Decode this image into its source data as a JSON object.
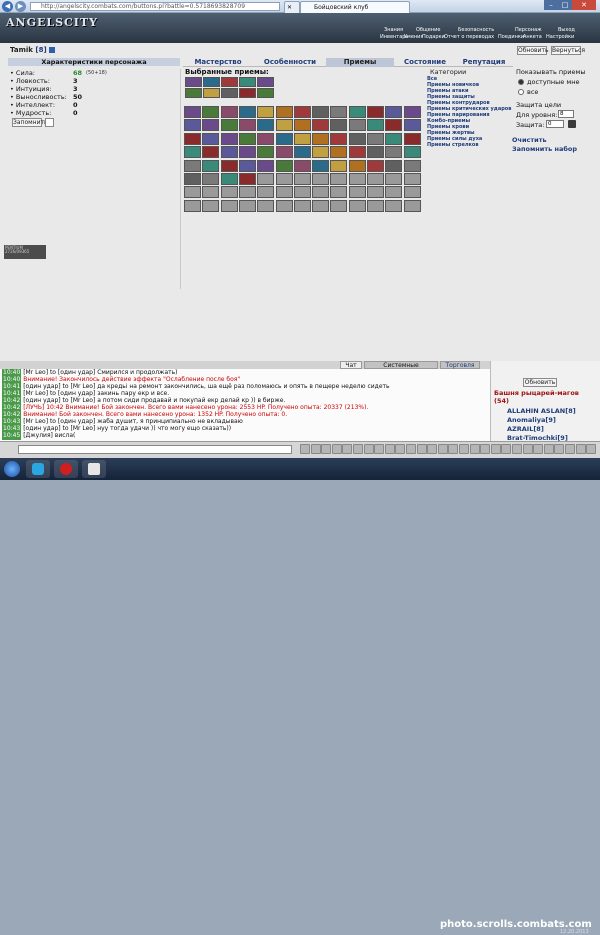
{
  "browser": {
    "url": "http://angelscity.combats.com/buttons.pl?battle=0.5718693828709",
    "tab_title": "Бойцовский клуб",
    "back_icon": "back-arrow-icon",
    "forward_icon": "forward-arrow-icon"
  },
  "game": {
    "logo": "ANGELSCITY",
    "menu_top": [
      "Знания",
      "Общение",
      "Безопасность",
      "Персонаж",
      "Выход"
    ],
    "menu_bottom": [
      "Инвентарь",
      "Умения",
      "Подарки",
      "Отчет о переводах",
      "Поединки",
      "Анкета",
      "Настройки"
    ]
  },
  "character": {
    "name": "Tamik",
    "level": "[8]",
    "update_btn": "Обновить",
    "back_btn": "Вернуться"
  },
  "stats": {
    "title": "Характеристики персонажа",
    "rows": [
      {
        "label": "Сила:",
        "value": "68",
        "bonus": "(50+18)"
      },
      {
        "label": "Ловкость:",
        "value": "3",
        "bonus": ""
      },
      {
        "label": "Интуиция:",
        "value": "3",
        "bonus": ""
      },
      {
        "label": "Выносливость:",
        "value": "50",
        "bonus": ""
      },
      {
        "label": "Интеллект:",
        "value": "0",
        "bonus": ""
      },
      {
        "label": "Мудрость:",
        "value": "0",
        "bonus": ""
      }
    ],
    "remember_btn": "Запомнить"
  },
  "tabs": [
    "Мастерство",
    "Особенности",
    "Приемы",
    "Состояние",
    "Репутация"
  ],
  "active_tab": "Приемы",
  "selected_label": "Выбранные приемы:",
  "categories": {
    "title": "Категории",
    "items": [
      "Все",
      "Приемы новичков",
      "Приемы атаки",
      "Приемы защиты",
      "Приемы контрударов",
      "Приемы критических ударов",
      "Приемы парирования",
      "Комбо-приемы",
      "Приемы крови",
      "Приемы жертвы",
      "Приемы силы духа",
      "Приемы стрелков"
    ]
  },
  "show_panel": {
    "title": "Показывать приемы",
    "opt_available": "доступные мне",
    "opt_all": "все",
    "target_label": "Защита цели",
    "level_label": "Для уровня:",
    "level_value": "8",
    "protect_label": "Защита:",
    "protect_value": "0",
    "clear": "Очистить",
    "remember_set": "Запомнить набор"
  },
  "stamp": "PENTIUM 2726/09365",
  "chat": {
    "tabs": [
      "Чат",
      "Системные сообщения",
      "Торговля"
    ],
    "lines": [
      {
        "time": "10:40",
        "text": "[Mr Leo] to [один удар] Смирился и продолжать)"
      },
      {
        "time": "10:40",
        "text": "Внимание! Закончилось действие эффекта \"Ослабление после боя\""
      },
      {
        "time": "10:41",
        "text": "[один удар] to [Mr Leo] да кредьі на ремонт закончились, ша ещё раз поломаюсь и опять в пещере неделю сидеть"
      },
      {
        "time": "10:41",
        "text": "[Mr Leo] to [один удар] закинь пару екр и все."
      },
      {
        "time": "10:42",
        "text": "[один удар] to [Mr Leo] а потом сиди продавай и покупай екр делай кр )) в бирже."
      },
      {
        "time": "10:42",
        "text": "[ЛУЧЬ] 10:42 Внимание! Бой закончен. Всего вами нанесено урона: 2553 HP. Получено опыта: 20337 (213%)."
      },
      {
        "time": "10:42",
        "text": "Внимание! Бой закончен. Всего вами нанесено урона: 1352 HP. Получено опыта: 0."
      },
      {
        "time": "10:43",
        "text": "[Mr Leo] to [один удар] жаба душит, я принципиально не вкладываю"
      },
      {
        "time": "10:43",
        "text": "[один удар] to [Mr Leo] нуу тогда удачи )) что могу ещо сказать))"
      },
      {
        "time": "10:45",
        "text": "[Джулия] висла("
      }
    ]
  },
  "online": {
    "update_btn": "Обновить",
    "room": "Башня рыцарей-магов",
    "count": "(54)",
    "users": [
      "ALLAHIN ASLAN[8]",
      "Anomaliya[9]",
      "AZRAIL[8]",
      "Brat-Timochki[9]"
    ]
  },
  "watermark": "photo.scrolls.combats.com",
  "clock": "12.20.2013"
}
